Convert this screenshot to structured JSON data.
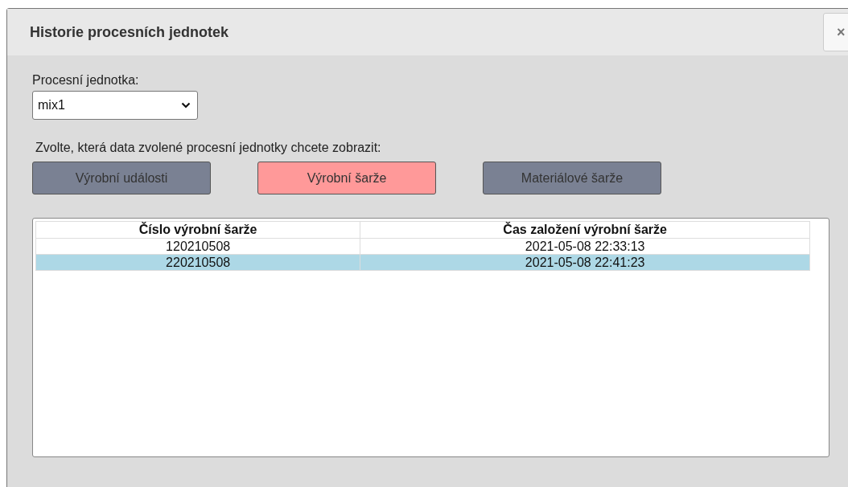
{
  "dialog": {
    "title": "Historie procesních jednotek",
    "close": "×"
  },
  "unit_field": {
    "label": "Procesní jednotka:",
    "value": "mix1"
  },
  "instruction": "Zvolte, která data zvolené procesní jednotky chcete zobrazit:",
  "views": [
    {
      "label": "Výrobní události",
      "selected": false
    },
    {
      "label": "Výrobní šarže",
      "selected": true
    },
    {
      "label": "Materiálové šarže",
      "selected": false
    }
  ],
  "table": {
    "columns": [
      "Číslo výrobní šarže",
      "Čas založení výrobní šarže"
    ],
    "rows": [
      {
        "cells": [
          "120210508",
          "2021-05-08 22:33:13"
        ],
        "selected": false
      },
      {
        "cells": [
          "220210508",
          "2021-05-08 22:41:23"
        ],
        "selected": true
      }
    ]
  }
}
